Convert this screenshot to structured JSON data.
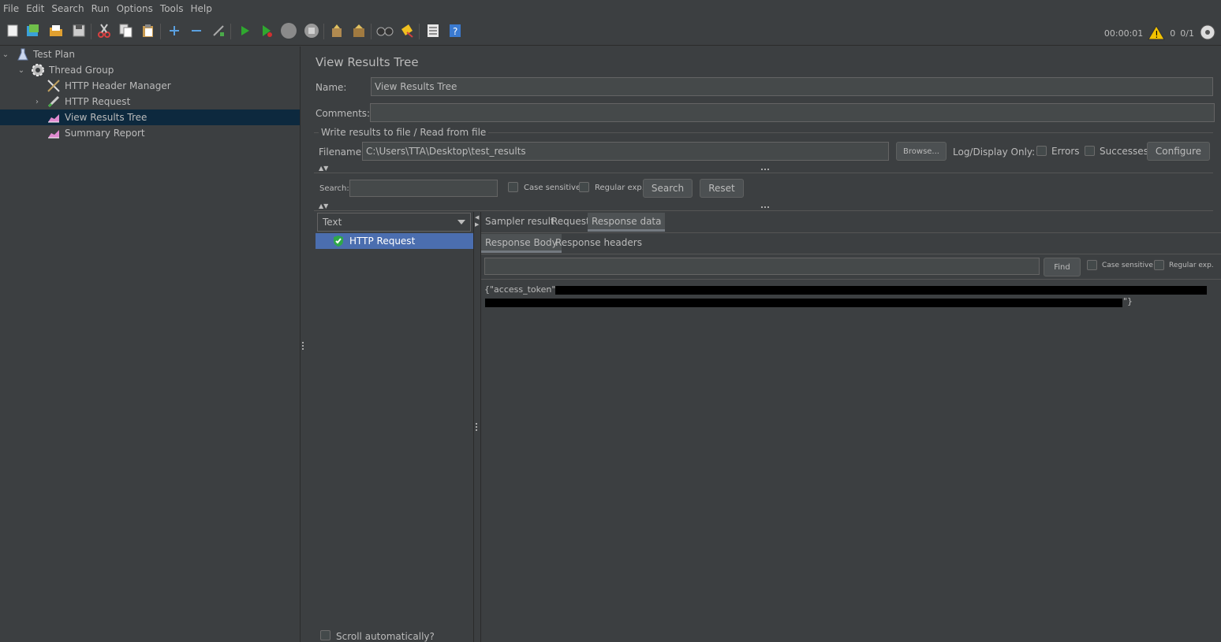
{
  "menu": [
    "File",
    "Edit",
    "Search",
    "Run",
    "Options",
    "Tools",
    "Help"
  ],
  "toolbar": {
    "icons": [
      "new-icon",
      "templates-icon",
      "open-icon",
      "save-icon",
      "cut-icon",
      "copy-icon",
      "paste-icon",
      "expand-icon",
      "collapse-icon",
      "toggle-icon",
      "start-icon",
      "start-no-pause-icon",
      "stop-icon",
      "shutdown-icon",
      "clear-icon",
      "clear-all-icon",
      "search-icon",
      "reset-search-icon",
      "function-helper-icon",
      "help-icon"
    ],
    "timer": "00:00:01",
    "warning_count": "0",
    "threads": "0/1"
  },
  "tree": {
    "items": [
      {
        "label": "Test Plan",
        "icon": "flask-icon"
      },
      {
        "label": "Thread Group",
        "icon": "gear-icon"
      },
      {
        "label": "HTTP Header Manager",
        "icon": "tools-icon"
      },
      {
        "label": "HTTP Request",
        "icon": "pen-icon"
      },
      {
        "label": "View Results Tree",
        "icon": "chart-icon"
      },
      {
        "label": "Summary Report",
        "icon": "chart-icon"
      }
    ]
  },
  "panel": {
    "title": "View Results Tree",
    "name_label": "Name:",
    "name_value": "View Results Tree",
    "comments_label": "Comments:",
    "comments_value": "",
    "fileset_title": "Write results to file / Read from file",
    "filename_label": "Filename",
    "filename_value": "C:\\Users\\TTA\\Desktop\\test_results",
    "browse_label": "Browse...",
    "log_display_label": "Log/Display Only:",
    "errors_label": "Errors",
    "successes_label": "Successes",
    "configure_label": "Configure",
    "search_label": "Search:",
    "search_value": "",
    "case_sensitive_label": "Case sensitive",
    "regular_exp_label": "Regular exp.",
    "search_button": "Search",
    "reset_button": "Reset",
    "renderer_selected": "Text",
    "result_item": "HTTP Request",
    "scroll_auto_label": "Scroll automatically?",
    "tabs": [
      "Sampler result",
      "Request",
      "Response data"
    ],
    "subtabs": [
      "Response Body",
      "Response headers"
    ],
    "find_value": "",
    "find_button": "Find",
    "find_case_label": "Case sensitive",
    "find_regex_label": "Regular exp.",
    "response_prefix": "{\"access_token\":\"",
    "response_suffix": "\"}"
  }
}
